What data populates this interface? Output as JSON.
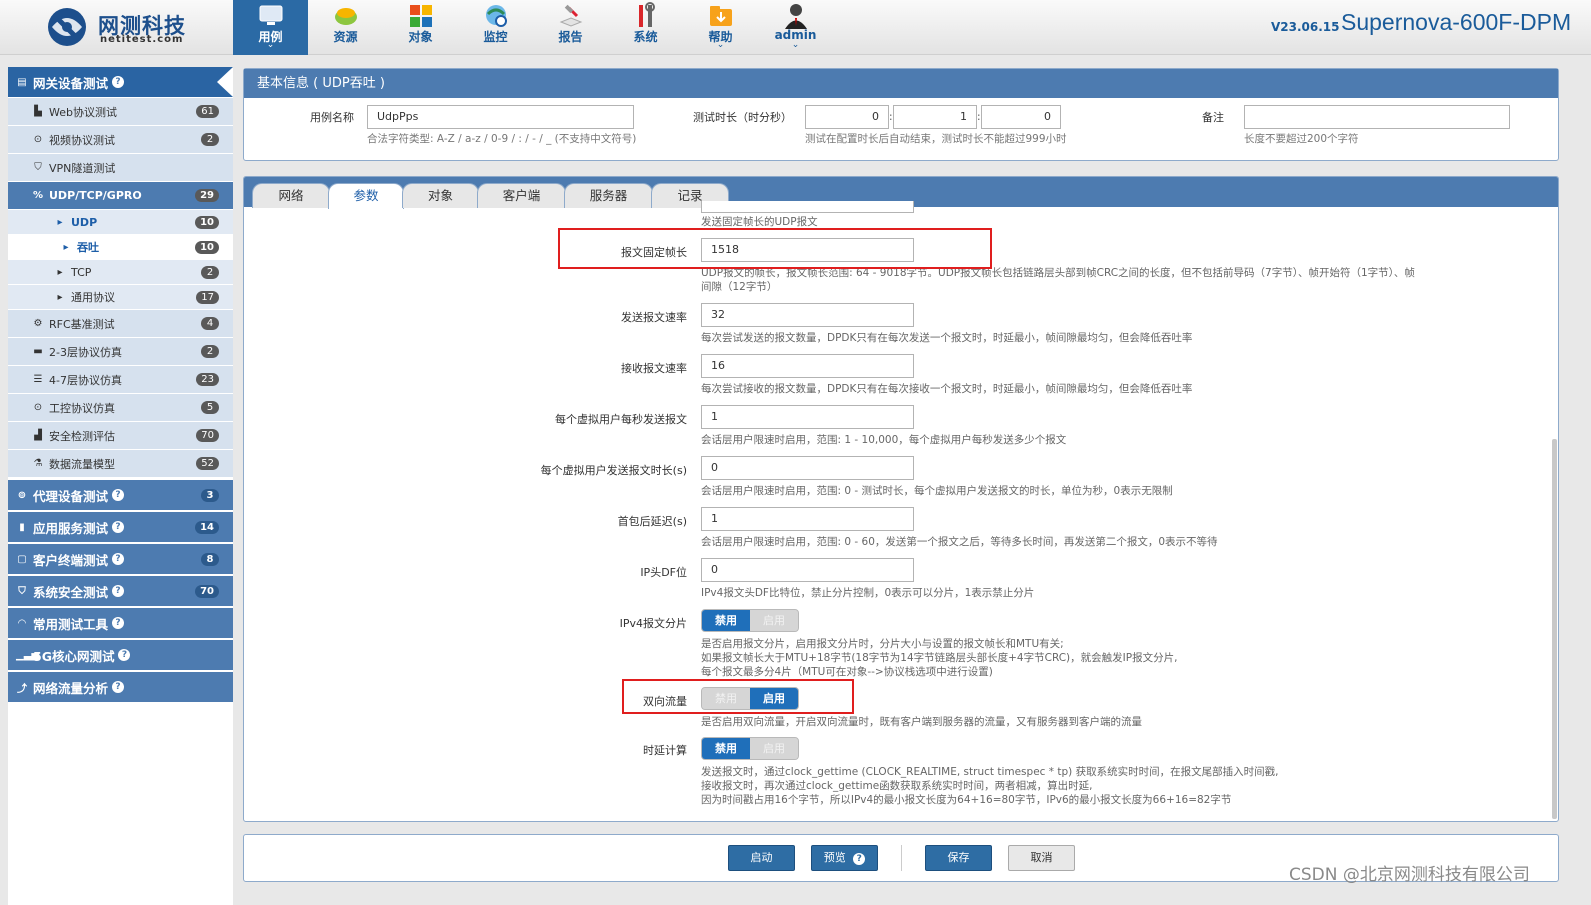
{
  "header": {
    "logo_name": "网测科技",
    "logo_domain": "netitest.com",
    "version": "V23.06.15",
    "model": "Supernova-600F-DPM",
    "nav": [
      {
        "label": "用例",
        "icon": "monitor-icon",
        "active": true,
        "caret": "⌄"
      },
      {
        "label": "资源",
        "icon": "resource-icon"
      },
      {
        "label": "对象",
        "icon": "object-icon"
      },
      {
        "label": "监控",
        "icon": "monitor-globe-icon"
      },
      {
        "label": "报告",
        "icon": "report-icon"
      },
      {
        "label": "系统",
        "icon": "tools-icon"
      },
      {
        "label": "帮助",
        "icon": "help-folder-icon",
        "caret": "⌄"
      },
      {
        "label": "admin",
        "icon": "user-icon",
        "caret": "⌄"
      }
    ]
  },
  "sidebar": {
    "items": [
      {
        "label": "网关设备测试",
        "badge": "",
        "help": "?"
      },
      {
        "label": "Web协议测试",
        "badge": "61"
      },
      {
        "label": "视频协议测试",
        "badge": "2"
      },
      {
        "label": "VPN隧道测试",
        "badge": ""
      },
      {
        "label": "UDP/TCP/GPRO",
        "badge": "29"
      },
      {
        "label": "UDP",
        "badge": "10"
      },
      {
        "label": "吞吐",
        "badge": "10"
      },
      {
        "label": "TCP",
        "badge": "2"
      },
      {
        "label": "通用协议",
        "badge": "17"
      },
      {
        "label": "RFC基准测试",
        "badge": "4"
      },
      {
        "label": "2-3层协议仿真",
        "badge": "2"
      },
      {
        "label": "4-7层协议仿真",
        "badge": "23"
      },
      {
        "label": "工控协议仿真",
        "badge": "5"
      },
      {
        "label": "安全检测评估",
        "badge": "70"
      },
      {
        "label": "数据流量模型",
        "badge": "52"
      },
      {
        "label": "代理设备测试",
        "badge": "3",
        "help": "?"
      },
      {
        "label": "应用服务测试",
        "badge": "14",
        "help": "?"
      },
      {
        "label": "客户终端测试",
        "badge": "8",
        "help": "?"
      },
      {
        "label": "系统安全测试",
        "badge": "70",
        "help": "?"
      },
      {
        "label": "常用测试工具",
        "badge": "",
        "help": "?"
      },
      {
        "label": "5G核心网测试",
        "badge": "",
        "help": "?"
      },
      {
        "label": "网络流量分析",
        "badge": "",
        "help": "?"
      }
    ]
  },
  "basic": {
    "title": "基本信息 ( UDP吞吐 )",
    "case_name_label": "用例名称",
    "case_name_value": "UdpPps",
    "case_name_hint": "合法字符类型: A-Z / a-z / 0-9 / : / - / _ (不支持中文符号)",
    "duration_label": "测试时长（时分秒）",
    "duration_h": "0",
    "duration_m": "1",
    "duration_s": "0",
    "duration_sep": ":",
    "duration_hint": "测试在配置时长后自动结束，测试时长不能超过999小时",
    "remark_label": "备注",
    "remark_value": "",
    "remark_hint": "长度不要超过200个字符"
  },
  "tabs": [
    "网络",
    "参数",
    "对象",
    "客户端",
    "服务器",
    "记录"
  ],
  "active_tab": "参数",
  "params": {
    "top_hint": "发送固定帧长的UDP报文",
    "frame_len": {
      "label": "报文固定帧长",
      "value": "1518",
      "hint1": "UDP报文的帧长，报文帧长范围: 64 - 9018字节。UDP报文帧长包括链路层头部到帧CRC之间的长度，但不包括前导码（7字节）、帧开始符（1字节）、帧",
      "hint2": "间隙（12字节）"
    },
    "send_rate": {
      "label": "发送报文速率",
      "value": "32",
      "hint": "每次尝试发送的报文数量，DPDK只有在每次发送一个报文时，时延最小，帧间隙最均匀，但会降低吞吐率"
    },
    "recv_rate": {
      "label": "接收报文速率",
      "value": "16",
      "hint": "每次尝试接收的报文数量，DPDK只有在每次接收一个报文时，时延最小，帧间隙最均匀，但会降低吞吐率"
    },
    "per_user_pps": {
      "label": "每个虚拟用户每秒发送报文",
      "value": "1",
      "hint": "会话层用户限速时启用，范围: 1 - 10,000，每个虚拟用户每秒发送多少个报文"
    },
    "per_user_duration": {
      "label": "每个虚拟用户发送报文时长(s)",
      "value": "0",
      "hint": "会话层用户限速时启用，范围: 0 - 测试时长，每个虚拟用户发送报文的时长，单位为秒，0表示无限制"
    },
    "first_delay": {
      "label": "首包后延迟(s)",
      "value": "1",
      "hint": "会话层用户限速时启用，范围: 0 - 60，发送第一个报文之后，等待多长时间，再发送第二个报文，0表示不等待"
    },
    "ip_df": {
      "label": "IP头DF位",
      "value": "0",
      "hint": "IPv4报文头DF比特位，禁止分片控制，0表示可以分片，1表示禁止分片"
    },
    "ipv4_frag": {
      "label": "IPv4报文分片",
      "off": "禁用",
      "on": "启用",
      "selected": "禁用",
      "hint1": "是否启用报文分片，启用报文分片时，分片大小与设置的报文帧长和MTU有关;",
      "hint2": "如果报文帧长大于MTU+18字节(18字节为14字节链路层头部长度+4字节CRC)，就会触发IP报文分片,",
      "hint3": "每个报文最多分4片（MTU可在对象-->协议栈选项中进行设置)"
    },
    "bidirectional": {
      "label": "双向流量",
      "off": "禁用",
      "on": "启用",
      "selected": "启用",
      "hint": "是否启用双向流量，开启双向流量时，既有客户端到服务器的流量，又有服务器到客户端的流量"
    },
    "latency": {
      "label": "时延计算",
      "off": "禁用",
      "on": "启用",
      "selected": "禁用",
      "hint1": "发送报文时，通过clock_gettime (CLOCK_REALTIME, struct timespec * tp) 获取系统实时时间，在报文尾部插入时间戳,",
      "hint2": "接收报文时，再次通过clock_gettime函数获取系统实时时间，两者相减，算出时延,",
      "hint3": "因为时间戳占用16个字节，所以IPv4的最小报文长度为64+16=80字节，IPv6的最小报文长度为66+16=82字节"
    }
  },
  "footer": {
    "start": "启动",
    "preview": "预览",
    "save": "保存",
    "cancel": "取消"
  },
  "watermark": "CSDN @北京网测科技有限公司"
}
